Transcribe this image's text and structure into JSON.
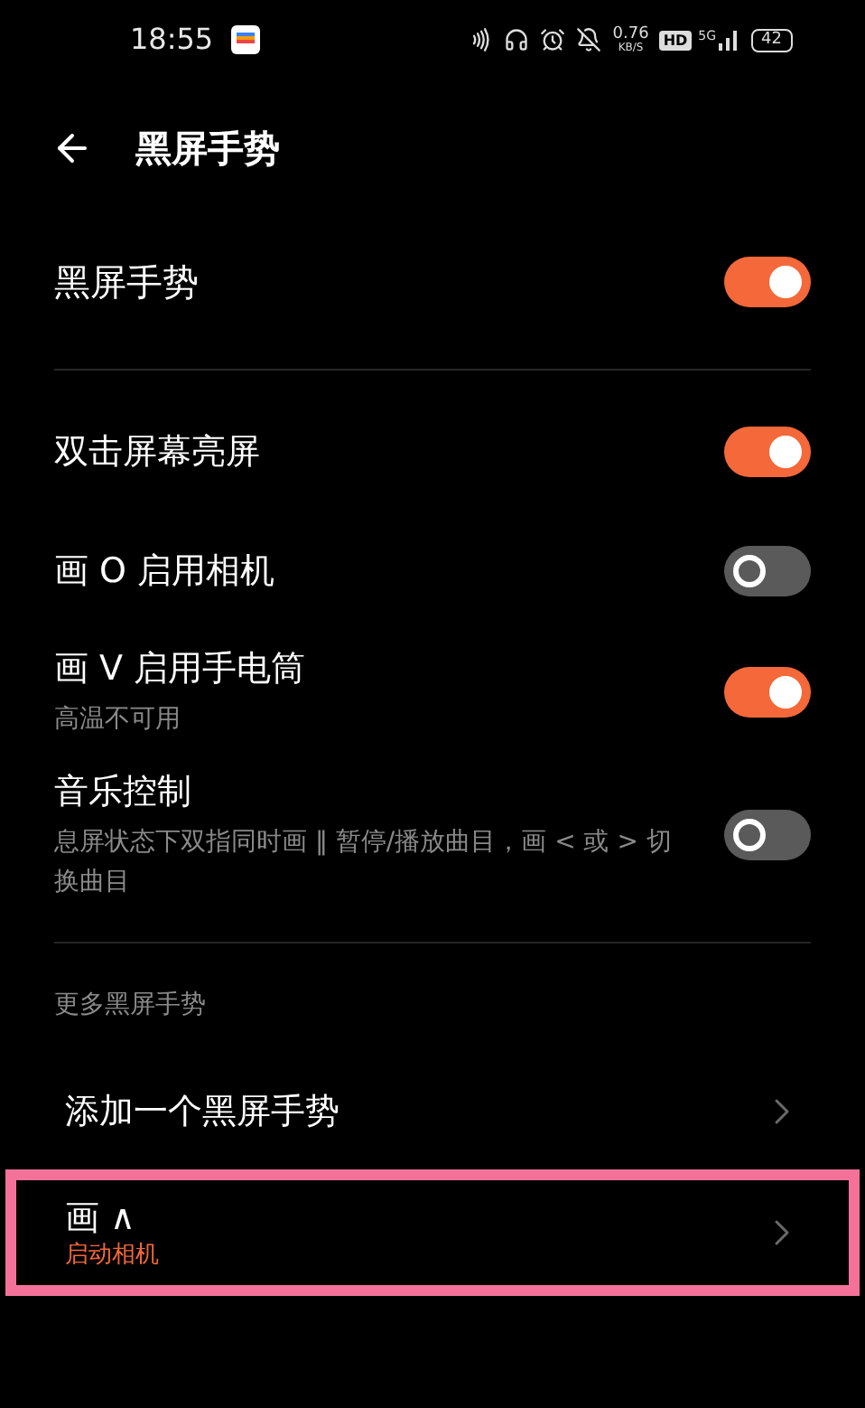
{
  "status_bar": {
    "time": "18:55",
    "speed_value": "0.76",
    "speed_unit": "KB/S",
    "hd": "HD",
    "network": "5G",
    "battery": "42"
  },
  "header": {
    "title": "黑屏手势"
  },
  "master": {
    "label": "黑屏手势",
    "on": true
  },
  "gestures": [
    {
      "label": "双击屏幕亮屏",
      "on": true
    },
    {
      "label": "画 O 启用相机",
      "on": false
    },
    {
      "label": "画 V 启用手电筒",
      "subtitle": "高温不可用",
      "on": true
    },
    {
      "label": "音乐控制",
      "subtitle": "息屏状态下双指同时画 ‖ 暂停/播放曲目，画 < 或 > 切换曲目",
      "on": false
    }
  ],
  "more": {
    "heading": "更多黑屏手势",
    "items": [
      {
        "label": "添加一个黑屏手势",
        "highlighted": false
      },
      {
        "label": "画 ∧",
        "subtitle": "启动相机",
        "highlighted": true
      }
    ]
  }
}
